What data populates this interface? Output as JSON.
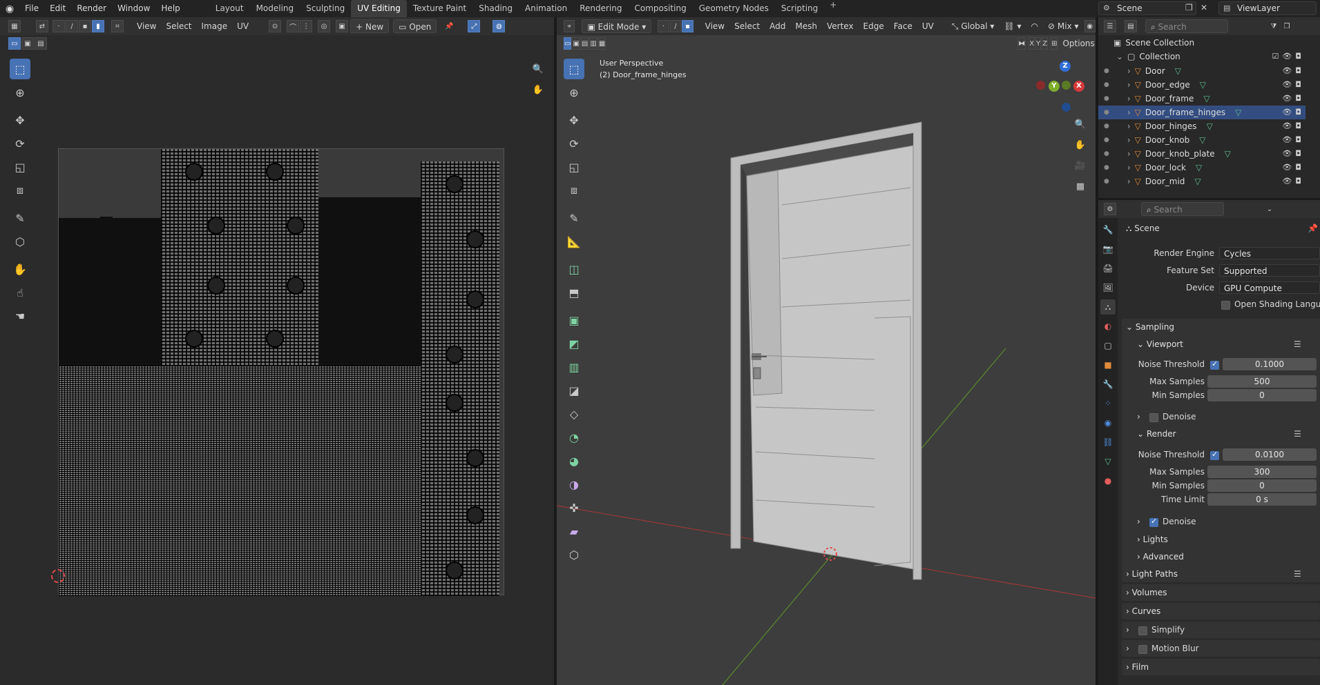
{
  "topbar": {
    "menus": [
      "File",
      "Edit",
      "Render",
      "Window",
      "Help"
    ],
    "workspaces": [
      "Layout",
      "Modeling",
      "Sculpting",
      "UV Editing",
      "Texture Paint",
      "Shading",
      "Animation",
      "Rendering",
      "Compositing",
      "Geometry Nodes",
      "Scripting"
    ],
    "active_workspace": "UV Editing",
    "add": "+",
    "scene": "Scene",
    "view_layer": "ViewLayer"
  },
  "uv_editor": {
    "menus": [
      "View",
      "Select",
      "Image",
      "UV"
    ],
    "new_label": "New",
    "open_label": "Open"
  },
  "viewport": {
    "mode": "Edit Mode",
    "menus": [
      "View",
      "Select",
      "Add",
      "Mesh",
      "Vertex",
      "Edge",
      "Face",
      "UV"
    ],
    "orientation": "Global",
    "shading": "Mix",
    "options_label": "Options",
    "axes": [
      "X",
      "Y",
      "Z"
    ],
    "view_name": "User Perspective",
    "active_object": "(2) Door_frame_hinges",
    "gizmo": {
      "x": "X",
      "y": "Y",
      "z": "Z"
    }
  },
  "outliner": {
    "search_placeholder": "Search",
    "root": "Scene Collection",
    "collection": "Collection",
    "objects": [
      "Door",
      "Door_edge",
      "Door_frame",
      "Door_frame_hinges",
      "Door_hinges",
      "Door_knob",
      "Door_knob_plate",
      "Door_lock",
      "Door_mid"
    ],
    "selected": "Door_frame_hinges"
  },
  "properties": {
    "search_placeholder": "Search",
    "context": "Scene",
    "render_engine_label": "Render Engine",
    "render_engine": "Cycles",
    "feature_set_label": "Feature Set",
    "feature_set": "Supported",
    "device_label": "Device",
    "device": "GPU Compute",
    "osl_label": "Open Shading Language",
    "sampling": "Sampling",
    "viewport": "Viewport",
    "vp_noise_label": "Noise Threshold",
    "vp_noise": "0.1000",
    "vp_max_label": "Max Samples",
    "vp_max": "500",
    "vp_min_label": "Min Samples",
    "vp_min": "0",
    "vp_denoise": "Denoise",
    "render": "Render",
    "r_noise_label": "Noise Threshold",
    "r_noise": "0.0100",
    "r_max_label": "Max Samples",
    "r_max": "300",
    "r_min_label": "Min Samples",
    "r_min": "0",
    "r_time_label": "Time Limit",
    "r_time": "0 s",
    "r_denoise": "Denoise",
    "lights": "Lights",
    "advanced": "Advanced",
    "light_paths": "Light Paths",
    "volumes": "Volumes",
    "curves": "Curves",
    "simplify": "Simplify",
    "motion_blur": "Motion Blur",
    "film": "Film"
  },
  "colors": {
    "accent": "#4772b3",
    "selection": "#334d80",
    "mesh_icon": "#e08a3a",
    "data_icon": "#5fbf8f"
  }
}
